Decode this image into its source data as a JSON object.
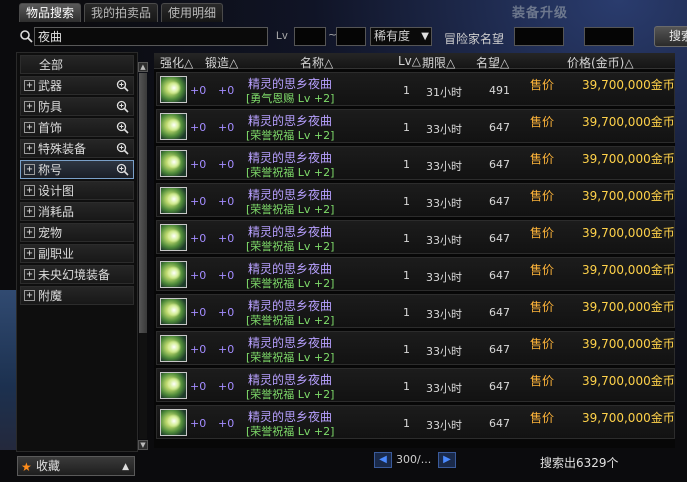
{
  "tabs": [
    "物品搜索",
    "我的拍卖品",
    "使用明细"
  ],
  "banner_text": "装备升级",
  "search": {
    "query": "夜曲",
    "lv_label": "Lv",
    "range_sep": "~",
    "rarity": "稀有度",
    "adv_label": "冒险家名望",
    "button": "搜索"
  },
  "categories": [
    {
      "label": "全部",
      "plus": false,
      "zoom": false,
      "selected": false
    },
    {
      "label": "武器",
      "plus": true,
      "zoom": true,
      "selected": false
    },
    {
      "label": "防具",
      "plus": true,
      "zoom": true,
      "selected": false
    },
    {
      "label": "首饰",
      "plus": true,
      "zoom": true,
      "selected": false
    },
    {
      "label": "特殊装备",
      "plus": true,
      "zoom": true,
      "selected": false
    },
    {
      "label": "称号",
      "plus": true,
      "zoom": true,
      "selected": true
    },
    {
      "label": "设计图",
      "plus": true,
      "zoom": false,
      "selected": false
    },
    {
      "label": "消耗品",
      "plus": true,
      "zoom": false,
      "selected": false
    },
    {
      "label": "宠物",
      "plus": true,
      "zoom": false,
      "selected": false
    },
    {
      "label": "副职业",
      "plus": true,
      "zoom": false,
      "selected": false
    },
    {
      "label": "未央幻境装备",
      "plus": true,
      "zoom": false,
      "selected": false
    },
    {
      "label": "附魔",
      "plus": true,
      "zoom": false,
      "selected": false
    }
  ],
  "favorites_label": "收藏",
  "table": {
    "headers": {
      "enhance": "强化△",
      "forge": "锻造△",
      "name": "名称△",
      "lv": "Lv△",
      "time": "期限△",
      "fame": "名望△",
      "price": "价格(金币)△"
    },
    "rows": [
      {
        "enhance": "+0",
        "forge": "+0",
        "name": "精灵的思乡夜曲",
        "sub": "[勇气恩赐 Lv +2]",
        "lv": "1",
        "time": "31小时",
        "fame": "491",
        "label": "售价",
        "price": "39,700,000金币"
      },
      {
        "enhance": "+0",
        "forge": "+0",
        "name": "精灵的思乡夜曲",
        "sub": "[荣誉祝福 Lv +2]",
        "lv": "1",
        "time": "33小时",
        "fame": "647",
        "label": "售价",
        "price": "39,700,000金币"
      },
      {
        "enhance": "+0",
        "forge": "+0",
        "name": "精灵的思乡夜曲",
        "sub": "[荣誉祝福 Lv +2]",
        "lv": "1",
        "time": "33小时",
        "fame": "647",
        "label": "售价",
        "price": "39,700,000金币"
      },
      {
        "enhance": "+0",
        "forge": "+0",
        "name": "精灵的思乡夜曲",
        "sub": "[荣誉祝福 Lv +2]",
        "lv": "1",
        "time": "33小时",
        "fame": "647",
        "label": "售价",
        "price": "39,700,000金币"
      },
      {
        "enhance": "+0",
        "forge": "+0",
        "name": "精灵的思乡夜曲",
        "sub": "[荣誉祝福 Lv +2]",
        "lv": "1",
        "time": "33小时",
        "fame": "647",
        "label": "售价",
        "price": "39,700,000金币"
      },
      {
        "enhance": "+0",
        "forge": "+0",
        "name": "精灵的思乡夜曲",
        "sub": "[荣誉祝福 Lv +2]",
        "lv": "1",
        "time": "33小时",
        "fame": "647",
        "label": "售价",
        "price": "39,700,000金币"
      },
      {
        "enhance": "+0",
        "forge": "+0",
        "name": "精灵的思乡夜曲",
        "sub": "[荣誉祝福 Lv +2]",
        "lv": "1",
        "time": "33小时",
        "fame": "647",
        "label": "售价",
        "price": "39,700,000金币"
      },
      {
        "enhance": "+0",
        "forge": "+0",
        "name": "精灵的思乡夜曲",
        "sub": "[荣誉祝福 Lv +2]",
        "lv": "1",
        "time": "33小时",
        "fame": "647",
        "label": "售价",
        "price": "39,700,000金币"
      },
      {
        "enhance": "+0",
        "forge": "+0",
        "name": "精灵的思乡夜曲",
        "sub": "[荣誉祝福 Lv +2]",
        "lv": "1",
        "time": "33小时",
        "fame": "647",
        "label": "售价",
        "price": "39,700,000金币"
      },
      {
        "enhance": "+0",
        "forge": "+0",
        "name": "精灵的思乡夜曲",
        "sub": "[荣誉祝福 Lv +2]",
        "lv": "1",
        "time": "33小时",
        "fame": "647",
        "label": "售价",
        "price": "39,700,000金币"
      }
    ]
  },
  "pager": {
    "page": "300/..."
  },
  "result_count": "搜索出6329个",
  "colors": {
    "price": "#ffd24a",
    "sale_label": "#ffb53a",
    "item_name": "#b7a0ff",
    "item_sub": "#7fdc6a",
    "favorite_star": "#ff8c1a"
  }
}
